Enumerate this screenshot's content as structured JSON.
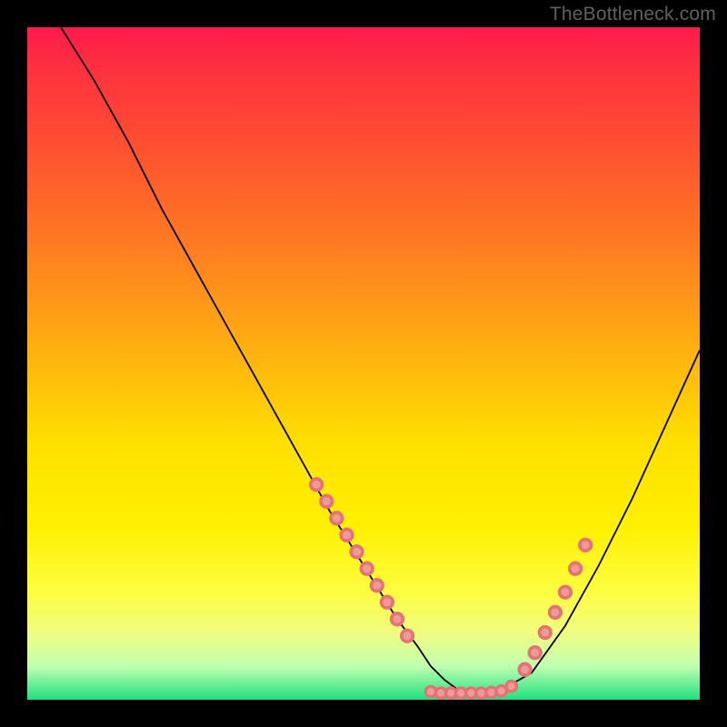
{
  "watermark": "TheBottleneck.com",
  "chart_data": {
    "type": "line",
    "title": "",
    "xlabel": "",
    "ylabel": "",
    "xlim": [
      0,
      100
    ],
    "ylim": [
      0,
      100
    ],
    "grid": false,
    "legend": false,
    "curve": {
      "x": [
        5,
        10,
        15,
        20,
        25,
        30,
        35,
        40,
        45,
        50,
        55,
        58,
        60,
        62,
        64,
        66,
        68,
        70,
        75,
        80,
        85,
        90,
        95,
        100
      ],
      "y": [
        100,
        92,
        83,
        73,
        64,
        55,
        46,
        37,
        28,
        20,
        12,
        8,
        5,
        3,
        1.5,
        1,
        1,
        1.2,
        4,
        11,
        20,
        30,
        41,
        52
      ]
    },
    "markers_left": {
      "x": [
        43,
        44.5,
        46,
        47.5,
        49,
        50.5,
        52,
        53.5,
        55,
        56.5
      ],
      "y": [
        32,
        29.5,
        27,
        24.5,
        22,
        19.5,
        17,
        14.5,
        12,
        9.5
      ]
    },
    "markers_right": {
      "x": [
        74,
        75.5,
        77,
        78.5,
        80,
        81.5,
        83
      ],
      "y": [
        4.5,
        7,
        10,
        13,
        16,
        19.5,
        23
      ]
    },
    "markers_bottom": {
      "x": [
        60,
        61.5,
        63,
        64.5,
        66,
        67.5,
        69,
        70.5,
        72
      ],
      "y": [
        1.2,
        1,
        1,
        1,
        1,
        1,
        1.1,
        1.3,
        2
      ]
    }
  }
}
